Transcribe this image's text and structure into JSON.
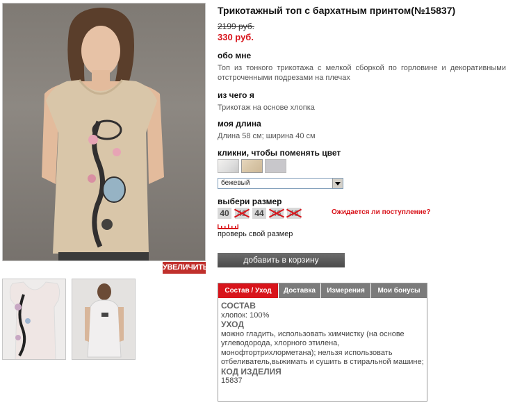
{
  "product": {
    "title": "Трикотажный топ с бархатным принтом(№15837)",
    "old_price": "2199 руб.",
    "new_price": "330 руб."
  },
  "images": {
    "enlarge_label": "УВЕЛИЧИТЬ"
  },
  "about": {
    "heading": "обо мне",
    "text": "Топ из тонкого трикотажа с мелкой сборкой по горловине и декоративными отстроченными подрезами на плечах"
  },
  "material": {
    "heading": "из чего я",
    "text": "Трикотаж на основе хлопка"
  },
  "length": {
    "heading": "моя длина",
    "text": "Длина 58 см; ширина 40 см"
  },
  "color": {
    "heading": "кликни, чтобы поменять цвет",
    "selected": "бежевый"
  },
  "size": {
    "heading": "выбери размер",
    "options": [
      {
        "label": "40",
        "available": true
      },
      {
        "label": "42",
        "available": false
      },
      {
        "label": "44",
        "available": true
      },
      {
        "label": "46",
        "available": false
      },
      {
        "label": "48",
        "available": false
      }
    ],
    "awaiting_label": "Ожидается ли поступление?",
    "check_size_label": "проверь свой размер"
  },
  "cart": {
    "add_label": "добавить в корзину"
  },
  "tabs": {
    "items": [
      {
        "label": "Состав / Уход"
      },
      {
        "label": "Доставка"
      },
      {
        "label": "Измерения"
      },
      {
        "label": "Мои бонусы"
      }
    ],
    "content": {
      "composition_heading": "СОСТАВ",
      "composition_value": "хлопок: 100%",
      "care_heading": "УХОД",
      "care_value": "можно гладить, использовать химчистку (на основе углеводорода, хлорного этилена, монофтортрихлорметана); нельзя использовать отбеливатель,выжимать и сушить в стиральной машине;",
      "code_heading": "КОД ИЗДЕЛИЯ",
      "code_value": "15837"
    }
  },
  "colors": {
    "accent": "#d8141b",
    "tab_inactive": "#7b7b7b",
    "button_dark": "#4a4a4a"
  }
}
